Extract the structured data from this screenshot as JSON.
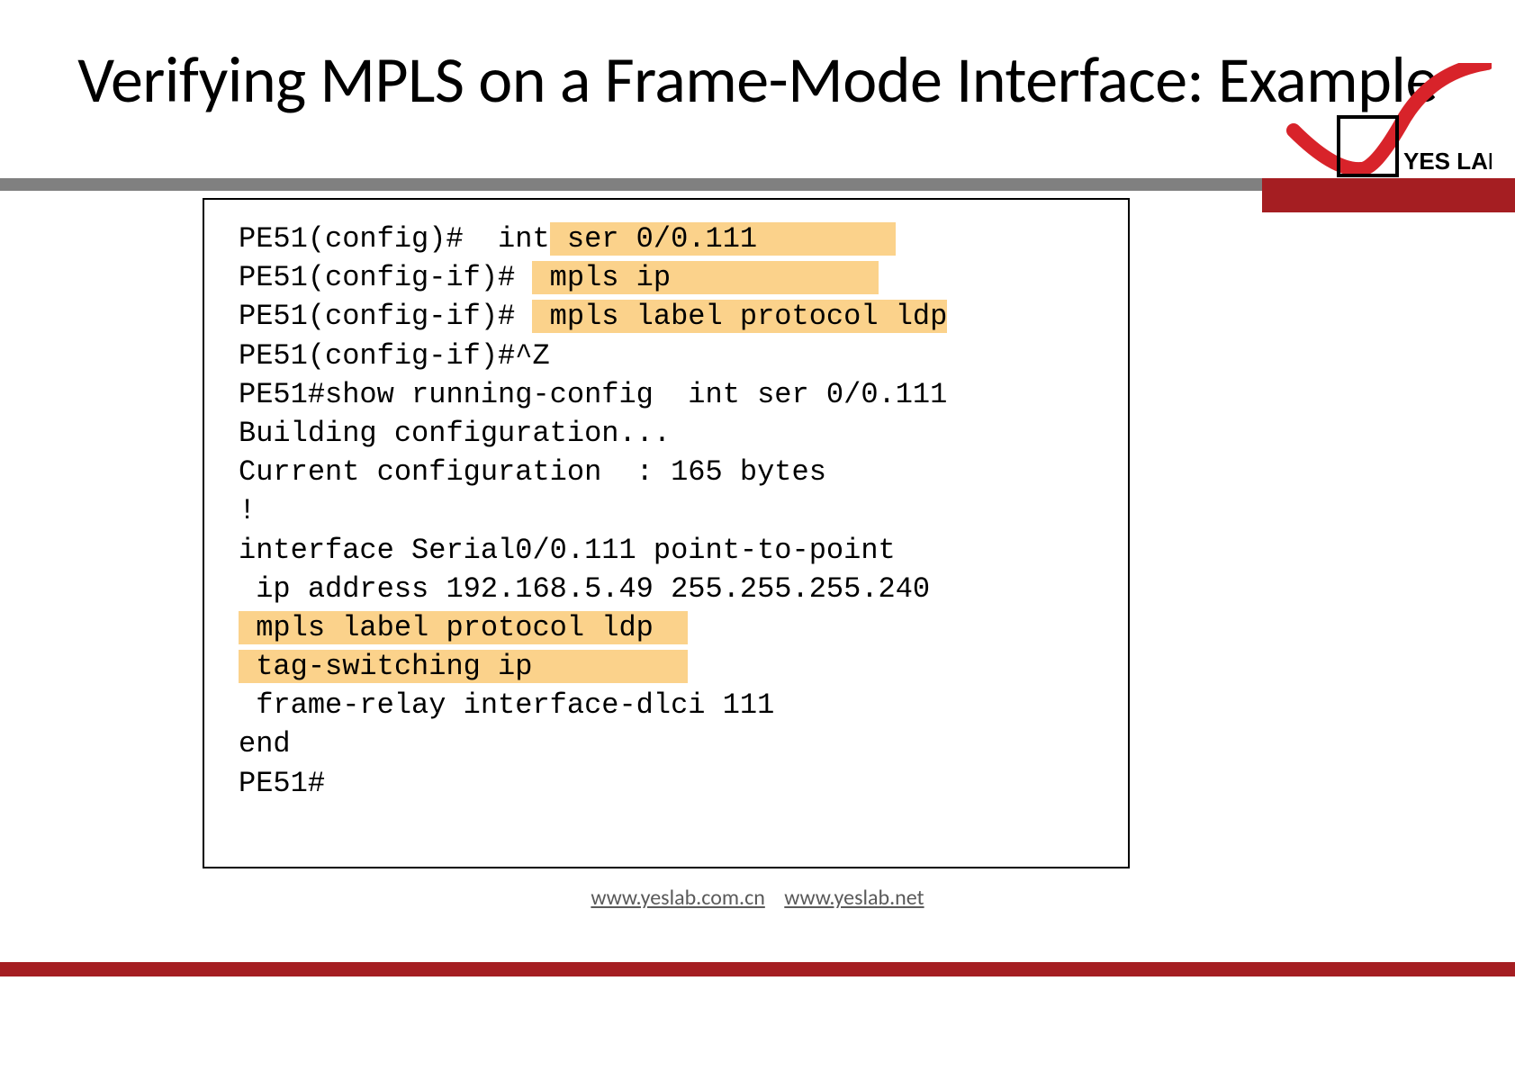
{
  "title": "Verifying MPLS on a Frame-Mode Interface: Example",
  "logo_text": "YES LAB",
  "code": {
    "l1a": "PE51(config)#  int",
    "l1b": " ser 0/0.111        ",
    "l2a": "PE51(config-if)# ",
    "l2b": " mpls ip            ",
    "l3a": "PE51(config-if)# ",
    "l3b": " mpls label protocol ldp",
    "l4": "PE51(config-if)#^Z",
    "l5": "",
    "l6": "PE51#show running-config  int ser 0/0.111",
    "l7": "Building configuration...",
    "l8": "Current configuration  : 165 bytes",
    "l9": "!",
    "l10": "interface Serial0/0.111 point-to-point",
    "l11": " ip address 192.168.5.49 255.255.255.240",
    "l12": " mpls label protocol ldp  ",
    "l13": " tag-switching ip         ",
    "l14": " frame-relay interface-dlci 111",
    "l15": "end",
    "l16": "PE51#"
  },
  "footer": {
    "link1": "www.yeslab.com.cn",
    "link2": "www.yeslab.net"
  }
}
